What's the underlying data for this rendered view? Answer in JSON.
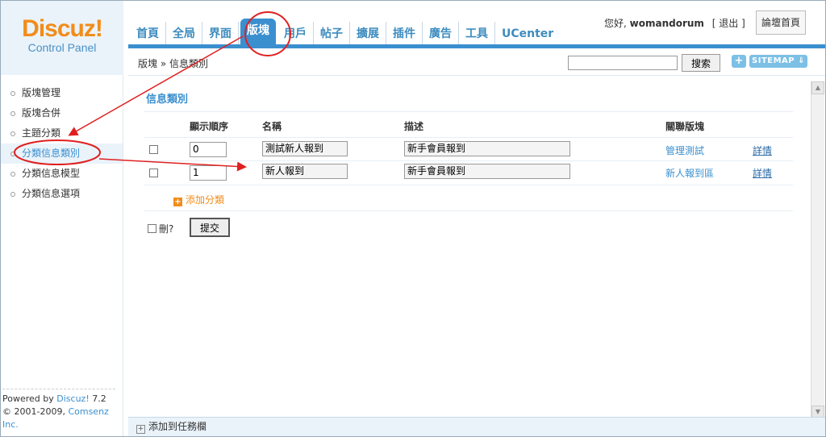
{
  "logo": {
    "main": "Discuz!",
    "sub": "Control Panel"
  },
  "nav": {
    "tabs": [
      {
        "label": "首頁",
        "active": false
      },
      {
        "label": "全局",
        "active": false
      },
      {
        "label": "界面",
        "active": false
      },
      {
        "label": "版塊",
        "active": true
      },
      {
        "label": "用戶",
        "active": false
      },
      {
        "label": "帖子",
        "active": false
      },
      {
        "label": "擴展",
        "active": false
      },
      {
        "label": "插件",
        "active": false
      },
      {
        "label": "廣告",
        "active": false
      },
      {
        "label": "工具",
        "active": false
      },
      {
        "label": "UCenter",
        "active": false
      }
    ]
  },
  "user": {
    "greeting": "您好,",
    "name": "womandorum",
    "logout": "[ 退出 ]",
    "forum_home": "論壇首頁"
  },
  "breadcrumb": {
    "text": "版塊 » 信息類別"
  },
  "search": {
    "button": "搜索",
    "plus": "+",
    "sitemap": "SITEMAP ⇓"
  },
  "sidebar": {
    "items": [
      {
        "label": "版塊管理",
        "active": false
      },
      {
        "label": "版塊合併",
        "active": false
      },
      {
        "label": "主題分類",
        "active": false
      },
      {
        "label": "分類信息類別",
        "active": true
      },
      {
        "label": "分類信息模型",
        "active": false
      },
      {
        "label": "分類信息選項",
        "active": false
      }
    ],
    "powered_prefix": "Powered by ",
    "powered_link": "Discuz!",
    "powered_version": " 7.2",
    "copyright_prefix": "© 2001-2009, ",
    "copyright_link": "Comsenz Inc."
  },
  "main": {
    "title": "信息類別",
    "columns": {
      "order": "顯示順序",
      "name": "名稱",
      "desc": "描述",
      "forums": "關聯版塊"
    },
    "rows": [
      {
        "order": "0",
        "name": "測試新人報到",
        "desc": "新手會員報到",
        "forum": "管理測試",
        "detail": "詳情"
      },
      {
        "order": "1",
        "name": "新人報到",
        "desc": "新手會員報到",
        "forum": "新人報到區",
        "detail": "詳情"
      }
    ],
    "add_label": "添加分類",
    "delete_label": "刪?",
    "submit_label": "提交"
  },
  "footer": {
    "taskbar_label": "添加到任務欄"
  },
  "colors": {
    "accent": "#3a8fcf",
    "logo_orange": "#f28c1a",
    "annotation_red": "#e02020"
  }
}
